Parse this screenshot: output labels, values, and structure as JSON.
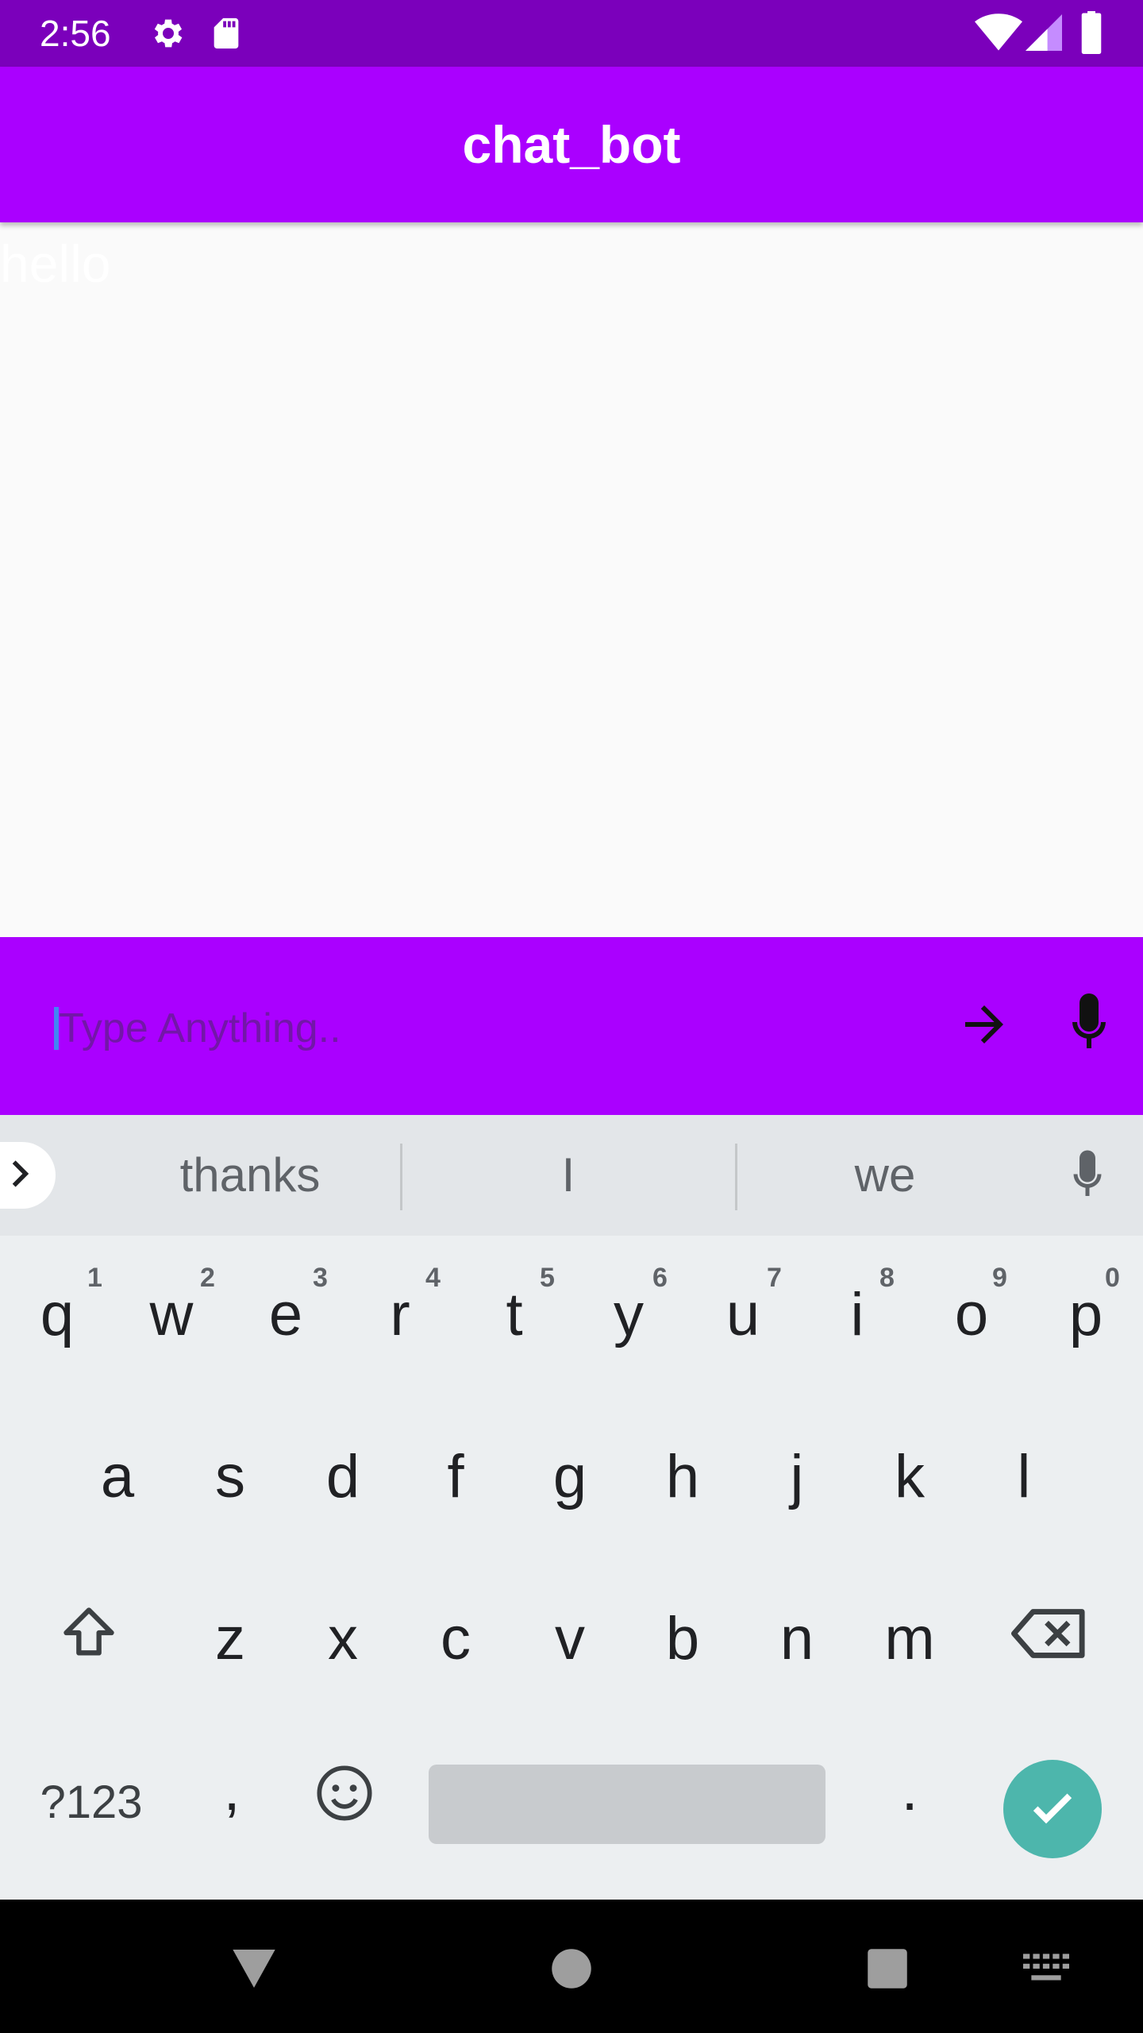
{
  "status_bar": {
    "time": "2:56",
    "icons": [
      "gear-icon",
      "sd-card-icon",
      "wifi-icon",
      "signal-icon",
      "battery-icon"
    ]
  },
  "app_bar": {
    "title": "chat_bot"
  },
  "chat": {
    "messages": [
      {
        "text": "hello"
      }
    ]
  },
  "input_bar": {
    "placeholder": "Type Anything..",
    "value": "",
    "send_icon": "arrow-right-icon",
    "mic_icon": "mic-icon"
  },
  "keyboard": {
    "suggestions": [
      "thanks",
      "I",
      "we"
    ],
    "row1": [
      "q",
      "w",
      "e",
      "r",
      "t",
      "y",
      "u",
      "i",
      "o",
      "p"
    ],
    "row1_hints": [
      "1",
      "2",
      "3",
      "4",
      "5",
      "6",
      "7",
      "8",
      "9",
      "0"
    ],
    "row2": [
      "a",
      "s",
      "d",
      "f",
      "g",
      "h",
      "j",
      "k",
      "l"
    ],
    "row3": [
      "z",
      "x",
      "c",
      "v",
      "b",
      "n",
      "m"
    ],
    "symbols_label": "?123",
    "comma": ",",
    "period": ".",
    "accent_color": "#4db6ac"
  },
  "colors": {
    "primary": "#aa00ff",
    "status_bar": "#7b00bb"
  }
}
